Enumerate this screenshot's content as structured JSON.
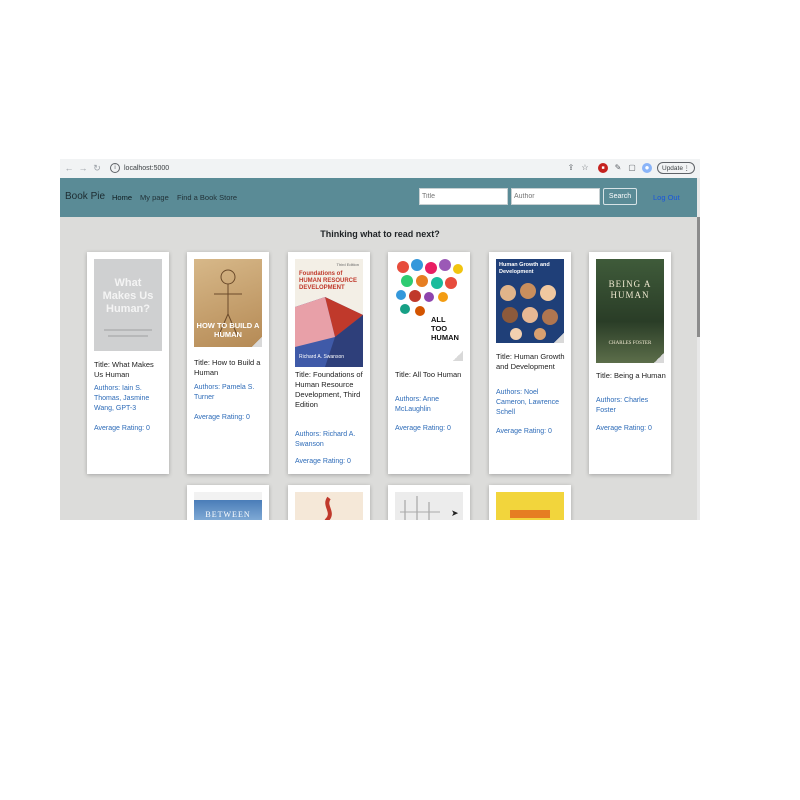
{
  "browser": {
    "url": "localhost:5000",
    "update_label": "Update"
  },
  "navbar": {
    "brand": "Book Pie",
    "links": [
      "Home",
      "My page",
      "Find a Book Store"
    ],
    "title_placeholder": "Title",
    "author_placeholder": "Author",
    "search_label": "Search",
    "logout_label": "Log Out"
  },
  "heading": "Thinking what to read next?",
  "books": [
    {
      "title": "Title: What Makes Us Human",
      "authors": "Authors: Iain S. Thomas, Jasmine Wang, GPT-3",
      "rating": "Average Rating: 0",
      "cover_text": "What Makes Us Human?"
    },
    {
      "title": "Title: How to Build a Human",
      "authors": "Authors: Pamela S. Turner",
      "rating": "Average Rating: 0",
      "cover_text": "HOW TO BUILD A HUMAN"
    },
    {
      "title": "Title: Foundations of Human Resource Development, Third Edition",
      "authors": "Authors: Richard A. Swanson",
      "rating": "Average Rating: 0",
      "cover_text": "Foundations of HUMAN RESOURCE DEVELOPMENT",
      "cover_edition": "Third Edition",
      "cover_author": "Richard A. Swanson"
    },
    {
      "title": "Title: All Too Human",
      "authors": "Authors: Anne McLaughlin",
      "rating": "Average Rating: 0",
      "cover_text": "ALL TOO HUMAN"
    },
    {
      "title": "Title: Human Growth and Development",
      "authors": "Authors: Noel Cameron, Lawrence Schell",
      "rating": "Average Rating: 0",
      "cover_text": "Human Growth and Development"
    },
    {
      "title": "Title: Being a Human",
      "authors": "Authors: Charles Foster",
      "rating": "Average Rating: 0",
      "cover_text": "BEING A HUMAN",
      "cover_author": "CHARLES FOSTER"
    }
  ],
  "second_row_covers": [
    {
      "cover_text": "BETWEEN"
    },
    {
      "cover_text": ""
    },
    {
      "cover_text": ""
    },
    {
      "cover_text": ""
    }
  ],
  "colors": {
    "navbar": "#5a8b96",
    "link_blue": "#2d6bb8",
    "page_bg": "#dcdcda"
  }
}
